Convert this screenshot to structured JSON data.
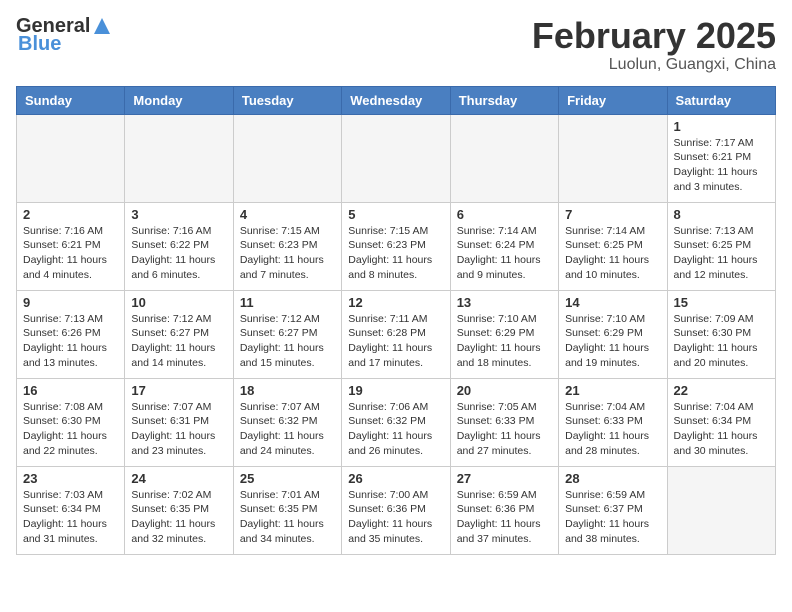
{
  "header": {
    "logo_general": "General",
    "logo_blue": "Blue",
    "month_title": "February 2025",
    "location": "Luolun, Guangxi, China"
  },
  "weekdays": [
    "Sunday",
    "Monday",
    "Tuesday",
    "Wednesday",
    "Thursday",
    "Friday",
    "Saturday"
  ],
  "weeks": [
    [
      {
        "day": "",
        "info": ""
      },
      {
        "day": "",
        "info": ""
      },
      {
        "day": "",
        "info": ""
      },
      {
        "day": "",
        "info": ""
      },
      {
        "day": "",
        "info": ""
      },
      {
        "day": "",
        "info": ""
      },
      {
        "day": "1",
        "info": "Sunrise: 7:17 AM\nSunset: 6:21 PM\nDaylight: 11 hours\nand 3 minutes."
      }
    ],
    [
      {
        "day": "2",
        "info": "Sunrise: 7:16 AM\nSunset: 6:21 PM\nDaylight: 11 hours\nand 4 minutes."
      },
      {
        "day": "3",
        "info": "Sunrise: 7:16 AM\nSunset: 6:22 PM\nDaylight: 11 hours\nand 6 minutes."
      },
      {
        "day": "4",
        "info": "Sunrise: 7:15 AM\nSunset: 6:23 PM\nDaylight: 11 hours\nand 7 minutes."
      },
      {
        "day": "5",
        "info": "Sunrise: 7:15 AM\nSunset: 6:23 PM\nDaylight: 11 hours\nand 8 minutes."
      },
      {
        "day": "6",
        "info": "Sunrise: 7:14 AM\nSunset: 6:24 PM\nDaylight: 11 hours\nand 9 minutes."
      },
      {
        "day": "7",
        "info": "Sunrise: 7:14 AM\nSunset: 6:25 PM\nDaylight: 11 hours\nand 10 minutes."
      },
      {
        "day": "8",
        "info": "Sunrise: 7:13 AM\nSunset: 6:25 PM\nDaylight: 11 hours\nand 12 minutes."
      }
    ],
    [
      {
        "day": "9",
        "info": "Sunrise: 7:13 AM\nSunset: 6:26 PM\nDaylight: 11 hours\nand 13 minutes."
      },
      {
        "day": "10",
        "info": "Sunrise: 7:12 AM\nSunset: 6:27 PM\nDaylight: 11 hours\nand 14 minutes."
      },
      {
        "day": "11",
        "info": "Sunrise: 7:12 AM\nSunset: 6:27 PM\nDaylight: 11 hours\nand 15 minutes."
      },
      {
        "day": "12",
        "info": "Sunrise: 7:11 AM\nSunset: 6:28 PM\nDaylight: 11 hours\nand 17 minutes."
      },
      {
        "day": "13",
        "info": "Sunrise: 7:10 AM\nSunset: 6:29 PM\nDaylight: 11 hours\nand 18 minutes."
      },
      {
        "day": "14",
        "info": "Sunrise: 7:10 AM\nSunset: 6:29 PM\nDaylight: 11 hours\nand 19 minutes."
      },
      {
        "day": "15",
        "info": "Sunrise: 7:09 AM\nSunset: 6:30 PM\nDaylight: 11 hours\nand 20 minutes."
      }
    ],
    [
      {
        "day": "16",
        "info": "Sunrise: 7:08 AM\nSunset: 6:30 PM\nDaylight: 11 hours\nand 22 minutes."
      },
      {
        "day": "17",
        "info": "Sunrise: 7:07 AM\nSunset: 6:31 PM\nDaylight: 11 hours\nand 23 minutes."
      },
      {
        "day": "18",
        "info": "Sunrise: 7:07 AM\nSunset: 6:32 PM\nDaylight: 11 hours\nand 24 minutes."
      },
      {
        "day": "19",
        "info": "Sunrise: 7:06 AM\nSunset: 6:32 PM\nDaylight: 11 hours\nand 26 minutes."
      },
      {
        "day": "20",
        "info": "Sunrise: 7:05 AM\nSunset: 6:33 PM\nDaylight: 11 hours\nand 27 minutes."
      },
      {
        "day": "21",
        "info": "Sunrise: 7:04 AM\nSunset: 6:33 PM\nDaylight: 11 hours\nand 28 minutes."
      },
      {
        "day": "22",
        "info": "Sunrise: 7:04 AM\nSunset: 6:34 PM\nDaylight: 11 hours\nand 30 minutes."
      }
    ],
    [
      {
        "day": "23",
        "info": "Sunrise: 7:03 AM\nSunset: 6:34 PM\nDaylight: 11 hours\nand 31 minutes."
      },
      {
        "day": "24",
        "info": "Sunrise: 7:02 AM\nSunset: 6:35 PM\nDaylight: 11 hours\nand 32 minutes."
      },
      {
        "day": "25",
        "info": "Sunrise: 7:01 AM\nSunset: 6:35 PM\nDaylight: 11 hours\nand 34 minutes."
      },
      {
        "day": "26",
        "info": "Sunrise: 7:00 AM\nSunset: 6:36 PM\nDaylight: 11 hours\nand 35 minutes."
      },
      {
        "day": "27",
        "info": "Sunrise: 6:59 AM\nSunset: 6:36 PM\nDaylight: 11 hours\nand 37 minutes."
      },
      {
        "day": "28",
        "info": "Sunrise: 6:59 AM\nSunset: 6:37 PM\nDaylight: 11 hours\nand 38 minutes."
      },
      {
        "day": "",
        "info": ""
      }
    ]
  ]
}
